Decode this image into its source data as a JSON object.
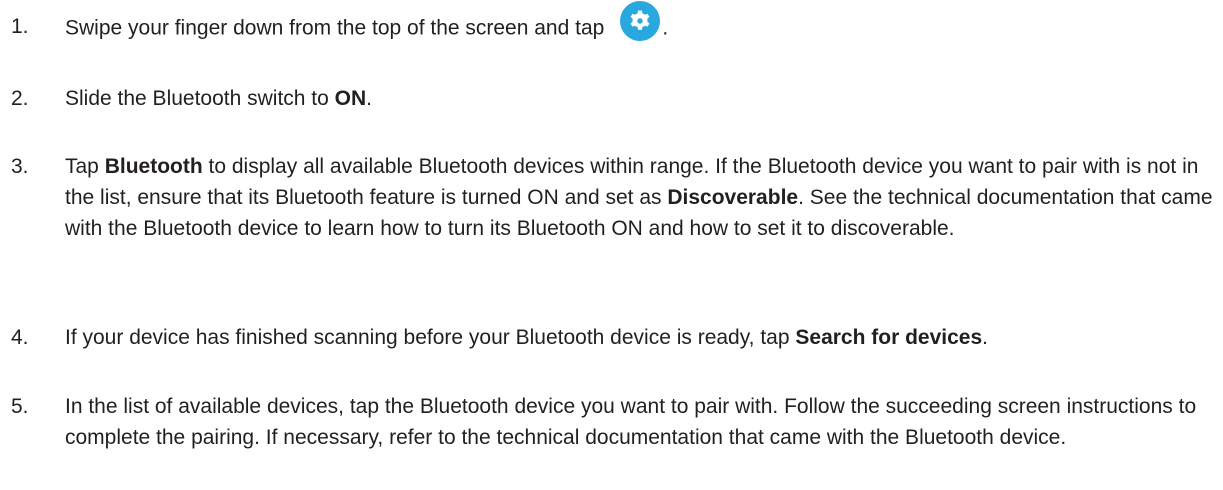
{
  "steps": [
    {
      "number": "1.",
      "text_before_icon": "Swipe your finger down from the top of the screen and tap",
      "icon": "settings-gear-icon",
      "text_after_icon": "."
    },
    {
      "number": "2.",
      "text_1": "Slide the Bluetooth switch to ",
      "bold_1": "ON",
      "text_2": "."
    },
    {
      "number": "3.",
      "text_1": "Tap ",
      "bold_1": "Bluetooth",
      "text_2": " to display all available Bluetooth devices within range. If the Bluetooth device you want to pair with is not in the list, ensure that its Bluetooth feature is turned ON and set as ",
      "bold_2": "Discoverable",
      "text_3": ". See the technical documentation that came with the Bluetooth device to learn how to turn its Bluetooth ON and how to set it to discoverable."
    },
    {
      "number": "4.",
      "text_1": "If your device has finished scanning before your Bluetooth device is ready, tap ",
      "bold_1": "Search for devices",
      "text_2": "."
    },
    {
      "number": "5.",
      "text_1": "In the list of available devices, tap the Bluetooth device you want to pair with. Follow the succeeding screen instructions to complete the pairing. If necessary, refer to the technical documentation that came with the Bluetooth device."
    }
  ],
  "colors": {
    "text": "#231f20",
    "icon_bg": "#29a8e0",
    "icon_fg": "#ffffff"
  }
}
